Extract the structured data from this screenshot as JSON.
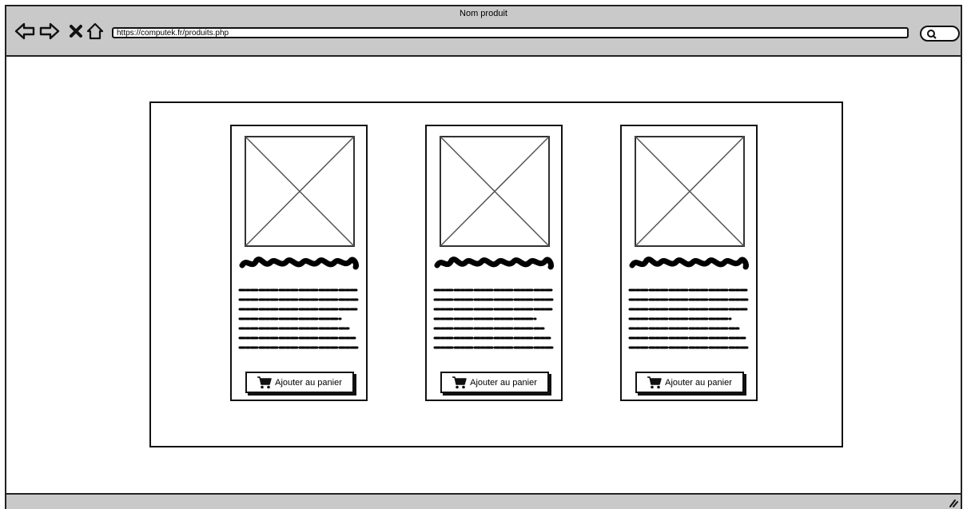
{
  "window": {
    "title": "Nom produit"
  },
  "toolbar": {
    "back_icon": "back-arrow-icon",
    "forward_icon": "forward-arrow-icon",
    "stop_icon": "close-icon",
    "home_icon": "home-icon",
    "url": "https://computek.fr/produits.php",
    "search_icon": "search-icon"
  },
  "products": [
    {
      "button_label": "Ajouter au panier",
      "button_icon": "cart-icon"
    },
    {
      "button_label": "Ajouter au panier",
      "button_icon": "cart-icon"
    },
    {
      "button_label": "Ajouter au panier",
      "button_icon": "cart-icon"
    }
  ]
}
